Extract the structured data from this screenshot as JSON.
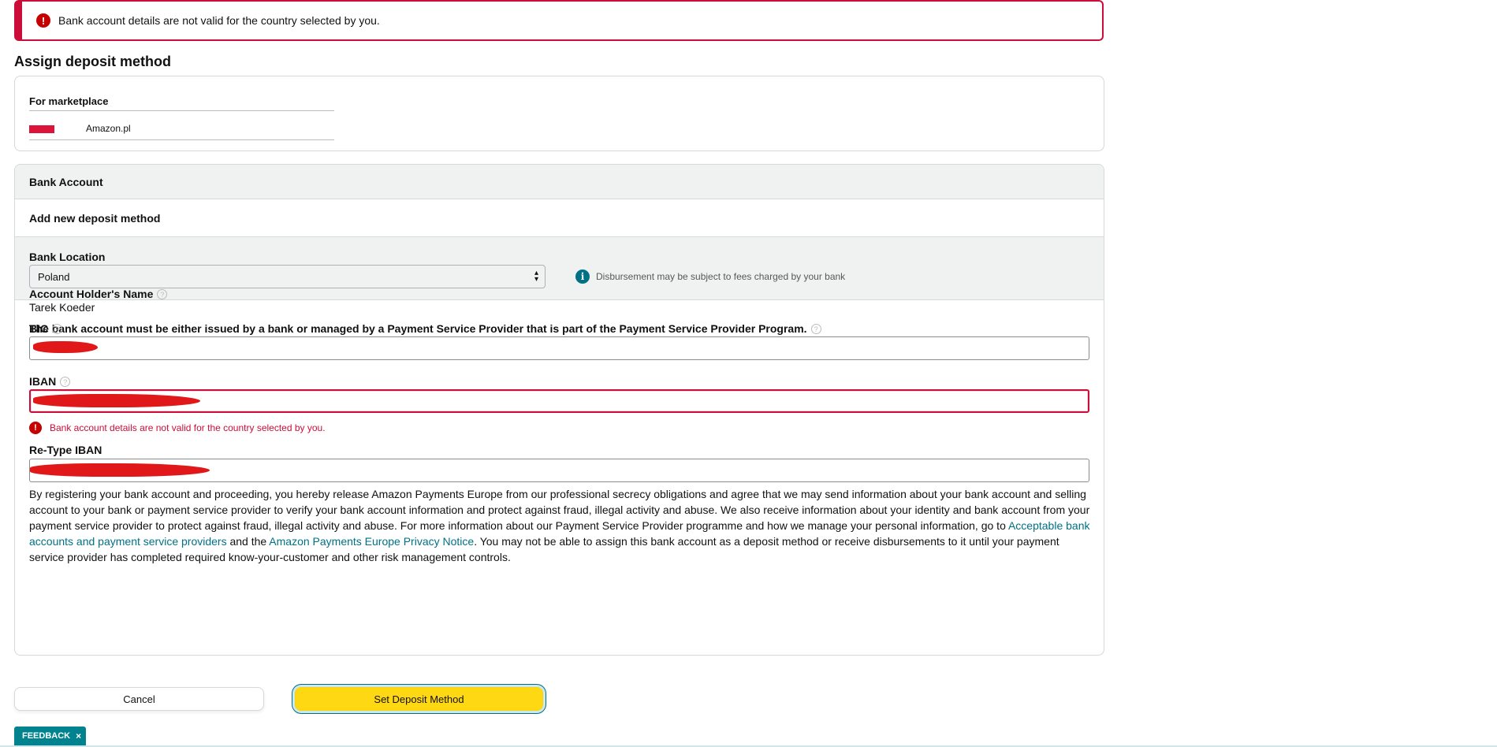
{
  "alert": {
    "icon": "error-icon",
    "message": "Bank account details are not valid for the country selected by you."
  },
  "page": {
    "title": "Assign deposit method"
  },
  "marketplace": {
    "label": "For marketplace",
    "flag_icon": "poland-flag-icon",
    "value": "Amazon.pl"
  },
  "bank_account": {
    "header": "Bank Account",
    "add_new": "Add new deposit method",
    "location": {
      "label": "Bank Location",
      "selected": "Poland",
      "info_icon": "info-icon",
      "info_text": "Disbursement may be subject to fees charged by your bank"
    },
    "notice": "The bank account must be either issued by a bank or managed by a Payment Service Provider that is part of the Payment Service Provider Program.",
    "holder": {
      "label": "Account Holder's Name",
      "value": "Tarek Koeder"
    },
    "bic": {
      "label": "BIC"
    },
    "iban": {
      "label": "IBAN",
      "error": "Bank account details are not valid for the country selected by you."
    },
    "retype_iban": {
      "label": "Re-Type IBAN"
    },
    "legal": {
      "part1": "By registering your bank account and proceeding, you hereby release Amazon Payments Europe from our professional secrecy obligations and agree that we may send information about your bank account and selling account to your bank or payment service provider to verify your bank account information and protect against fraud, illegal activity and abuse. We also receive information about your identity and bank account from your payment service provider to protect against fraud, illegal activity and abuse. For more information about our Payment Service Provider programme and how we manage your personal information, go to ",
      "link1": "Acceptable bank accounts and payment service providers",
      "part2": " and the ",
      "link2": "Amazon Payments Europe Privacy Notice",
      "part3": ". You may not be able to assign this bank account as a deposit method or receive disbursements to it until your payment service provider has completed required know-your-customer and other risk management controls."
    }
  },
  "actions": {
    "cancel": "Cancel",
    "submit": "Set Deposit Method"
  },
  "feedback": {
    "label": "FEEDBACK",
    "close": "×"
  },
  "colors": {
    "error": "#cc0c39",
    "link": "#007185",
    "primary_button": "#ffd814",
    "feedback_bg": "#00838f",
    "section_bg": "#f0f2f2"
  }
}
